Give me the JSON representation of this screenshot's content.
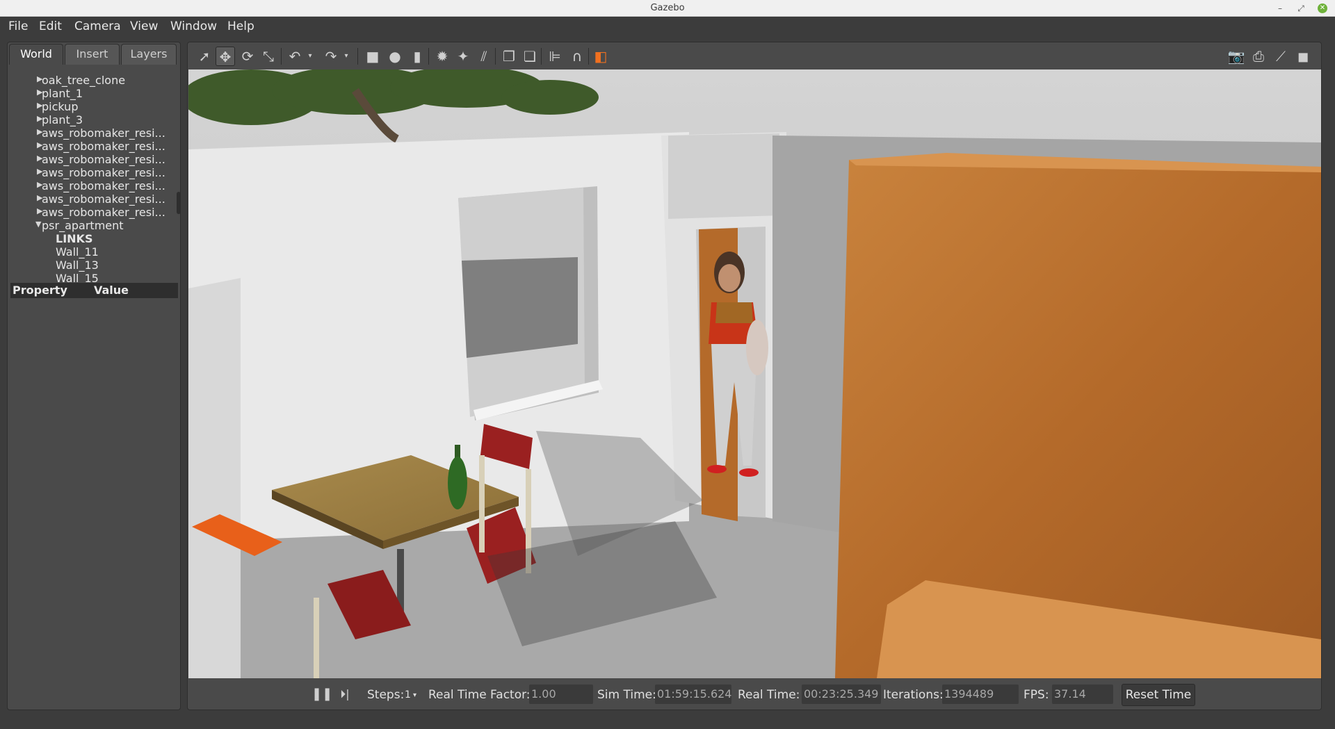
{
  "window": {
    "title": "Gazebo"
  },
  "menu": [
    "File",
    "Edit",
    "Camera",
    "View",
    "Window",
    "Help"
  ],
  "left_panel": {
    "tabs": [
      "World",
      "Insert",
      "Layers"
    ],
    "active_tab": "World",
    "tree": [
      {
        "label": "oak_tree_clone",
        "arrow": "▶"
      },
      {
        "label": "plant_1",
        "arrow": "▶"
      },
      {
        "label": "pickup",
        "arrow": "▶"
      },
      {
        "label": "plant_3",
        "arrow": "▶"
      },
      {
        "label": "aws_robomaker_resi...",
        "arrow": "▶"
      },
      {
        "label": "aws_robomaker_resi...",
        "arrow": "▶"
      },
      {
        "label": "aws_robomaker_resi...",
        "arrow": "▶"
      },
      {
        "label": "aws_robomaker_resi...",
        "arrow": "▶"
      },
      {
        "label": "aws_robomaker_resi...",
        "arrow": "▶"
      },
      {
        "label": "aws_robomaker_resi...",
        "arrow": "▶"
      },
      {
        "label": "aws_robomaker_resi...",
        "arrow": "▶"
      },
      {
        "label": "psr_apartment",
        "arrow": "▼"
      },
      {
        "label": "LINKS",
        "arrow": ""
      },
      {
        "label": "Wall_11",
        "arrow": ""
      },
      {
        "label": "Wall_13",
        "arrow": ""
      },
      {
        "label": "Wall_15",
        "arrow": ""
      }
    ],
    "property_header": {
      "property": "Property",
      "value": "Value"
    }
  },
  "toolbar": {
    "tools": [
      "select-arrow-icon",
      "translate-icon",
      "rotate-icon",
      "scale-icon",
      "undo-icon",
      "redo-icon",
      "box-icon",
      "sphere-icon",
      "cylinder-icon",
      "point-light-icon",
      "spot-light-icon",
      "directional-light-icon",
      "copy-icon",
      "paste-icon",
      "align-icon",
      "magnet-icon",
      "view-angle-icon",
      "screenshot-icon",
      "log-icon",
      "plot-icon",
      "video-icon"
    ]
  },
  "bottom_bar": {
    "steps_label": "Steps:",
    "steps_value": "1",
    "rtf_label": "Real Time Factor:",
    "rtf_value": "1.00",
    "sim_time_label": "Sim Time:",
    "sim_time_value": "01:59:15.624",
    "real_time_label": "Real Time:",
    "real_time_value": "00:23:25.349",
    "iterations_label": "Iterations:",
    "iterations_value": "1394489",
    "fps_label": "FPS:",
    "fps_value": "37.14",
    "reset_label": "Reset Time"
  }
}
